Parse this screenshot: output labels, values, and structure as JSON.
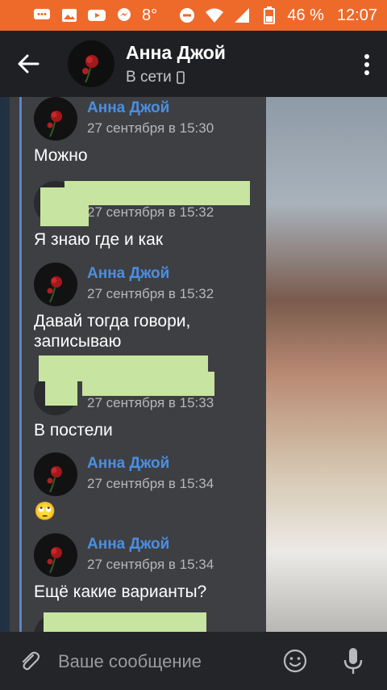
{
  "status_bar": {
    "temperature": "8°",
    "battery": "46 %",
    "time": "12:07"
  },
  "header": {
    "name": "Анна Джой",
    "status": "В сети"
  },
  "messages": [
    {
      "name": "Анна Джой",
      "time": "27 сентября в 15:30",
      "text": "Можно",
      "redacted": false
    },
    {
      "name": "",
      "time": "27 сентября в 15:32",
      "text": "Я знаю где и как",
      "redacted": true
    },
    {
      "name": "Анна Джой",
      "time": "27 сентября в 15:32",
      "text": "Давай тогда говори, записываю",
      "redacted": false
    },
    {
      "name": "",
      "time": "27 сентября в 15:33",
      "text": "В постели",
      "redacted": true
    },
    {
      "name": "Анна Джой",
      "time": "27 сентября в 15:34",
      "text": "🙄",
      "redacted": false
    },
    {
      "name": "Анна Джой",
      "time": "27 сентября в 15:34",
      "text": "Ещё какие варианты?",
      "redacted": false
    }
  ],
  "input": {
    "placeholder": "Ваше сообщение"
  }
}
